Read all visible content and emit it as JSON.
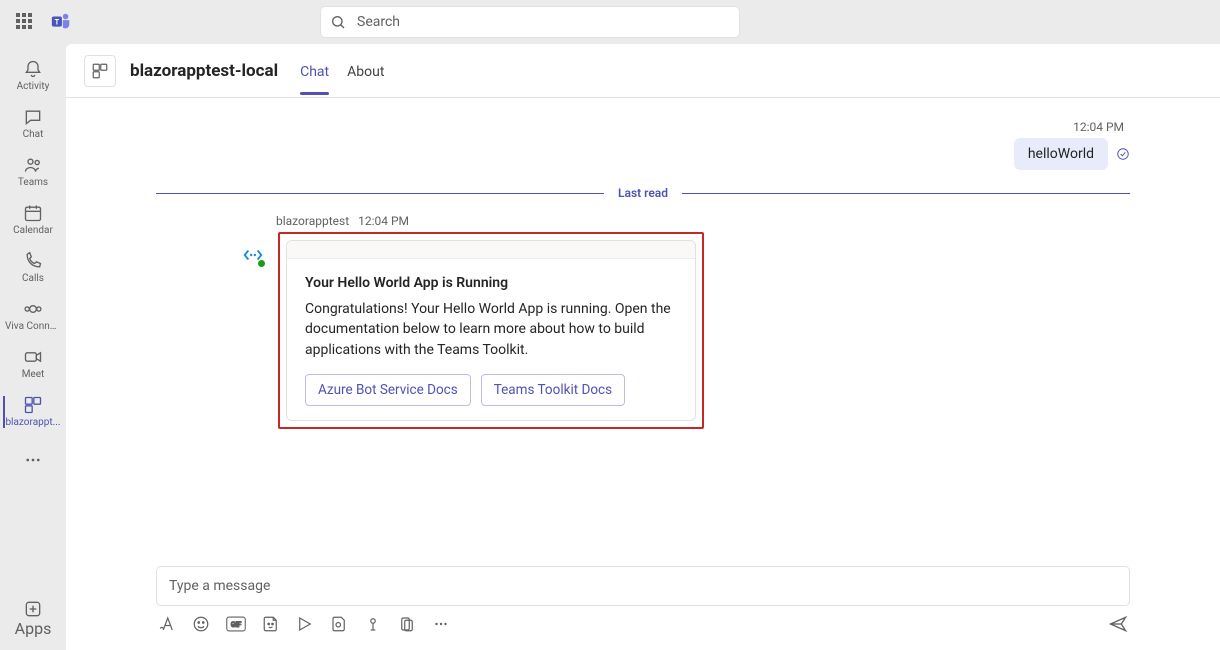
{
  "search_placeholder": "Search",
  "rail": {
    "items": [
      {
        "id": "activity",
        "label": "Activity"
      },
      {
        "id": "chat",
        "label": "Chat"
      },
      {
        "id": "teams",
        "label": "Teams"
      },
      {
        "id": "calendar",
        "label": "Calendar"
      },
      {
        "id": "calls",
        "label": "Calls"
      },
      {
        "id": "viva",
        "label": "Viva Conne..."
      },
      {
        "id": "meet",
        "label": "Meet"
      },
      {
        "id": "appactive",
        "label": "blazorappt..."
      }
    ],
    "apps_label": "Apps"
  },
  "header": {
    "title": "blazorapptest-local",
    "tabs": [
      {
        "label": "Chat",
        "active": true
      },
      {
        "label": "About",
        "active": false
      }
    ]
  },
  "conversation": {
    "outgoing": {
      "time": "12:04 PM",
      "text": "helloWorld"
    },
    "last_read_label": "Last read",
    "bot_message": {
      "sender": "blazorapptest",
      "time": "12:04 PM",
      "card": {
        "title": "Your Hello World App is Running",
        "text": "Congratulations! Your Hello World App is running. Open the documentation below to learn more about how to build applications with the Teams Toolkit.",
        "buttons": [
          {
            "label": "Azure Bot Service Docs"
          },
          {
            "label": "Teams Toolkit Docs"
          }
        ]
      }
    }
  },
  "compose": {
    "placeholder": "Type a message"
  }
}
